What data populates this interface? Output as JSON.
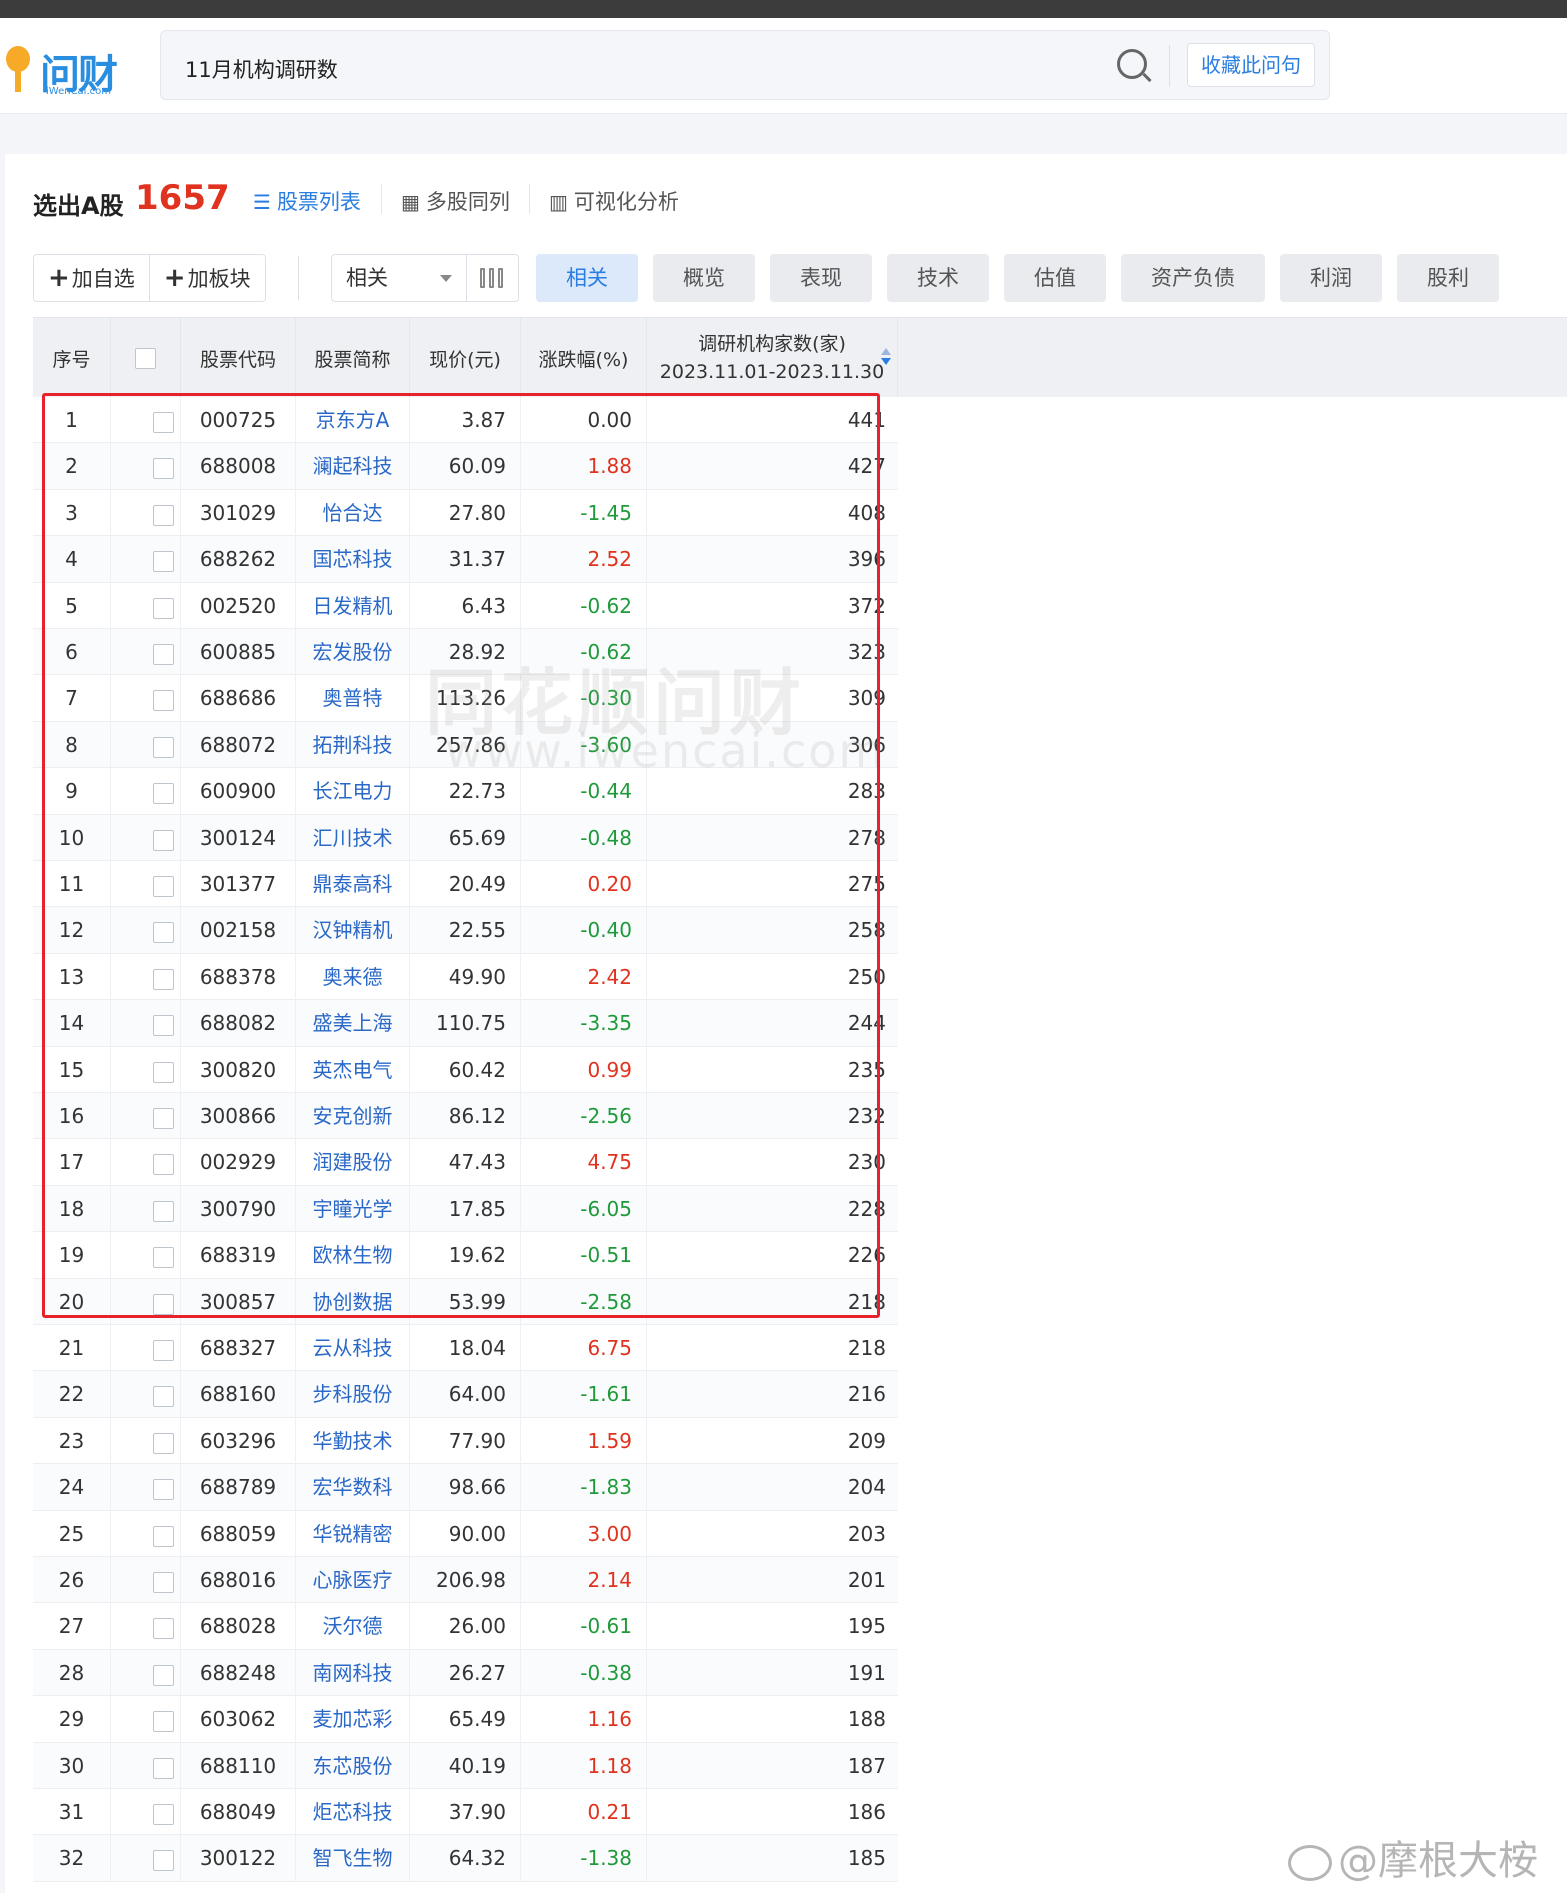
{
  "header": {
    "logo_text": "问财",
    "logo_sub": "iWenCai.com",
    "search_value": "11月机构调研数",
    "fav_label": "收藏此问句"
  },
  "result": {
    "label": "选出A股",
    "count": "1657"
  },
  "view_tabs": [
    {
      "label": "股票列表",
      "icon": "list-icon"
    },
    {
      "label": "多股同列",
      "icon": "grid-icon"
    },
    {
      "label": "可视化分析",
      "icon": "bar-chart-icon"
    }
  ],
  "toolbar": {
    "add_watch": "加自选",
    "add_block": "加板块",
    "select_value": "相关"
  },
  "categories": [
    "相关",
    "概览",
    "表现",
    "技术",
    "估值",
    "资产负债",
    "利润",
    "股利"
  ],
  "table": {
    "headers": {
      "idx": "序号",
      "code": "股票代码",
      "name": "股票简称",
      "price": "现价(元)",
      "chg": "涨跌幅(%)",
      "cnt_title": "调研机构家数(家)",
      "cnt_range": "2023.11.01-2023.11.30"
    },
    "rows": [
      {
        "idx": "1",
        "code": "000725",
        "name": "京东方A",
        "price": "3.87",
        "chg": "0.00",
        "dir": "flat",
        "cnt": "441"
      },
      {
        "idx": "2",
        "code": "688008",
        "name": "澜起科技",
        "price": "60.09",
        "chg": "1.88",
        "dir": "up",
        "cnt": "427"
      },
      {
        "idx": "3",
        "code": "301029",
        "name": "怡合达",
        "price": "27.80",
        "chg": "-1.45",
        "dir": "down",
        "cnt": "408"
      },
      {
        "idx": "4",
        "code": "688262",
        "name": "国芯科技",
        "price": "31.37",
        "chg": "2.52",
        "dir": "up",
        "cnt": "396"
      },
      {
        "idx": "5",
        "code": "002520",
        "name": "日发精机",
        "price": "6.43",
        "chg": "-0.62",
        "dir": "down",
        "cnt": "372"
      },
      {
        "idx": "6",
        "code": "600885",
        "name": "宏发股份",
        "price": "28.92",
        "chg": "-0.62",
        "dir": "down",
        "cnt": "323"
      },
      {
        "idx": "7",
        "code": "688686",
        "name": "奥普特",
        "price": "113.26",
        "chg": "-0.30",
        "dir": "down",
        "cnt": "309"
      },
      {
        "idx": "8",
        "code": "688072",
        "name": "拓荆科技",
        "price": "257.86",
        "chg": "-3.60",
        "dir": "down",
        "cnt": "306"
      },
      {
        "idx": "9",
        "code": "600900",
        "name": "长江电力",
        "price": "22.73",
        "chg": "-0.44",
        "dir": "down",
        "cnt": "283"
      },
      {
        "idx": "10",
        "code": "300124",
        "name": "汇川技术",
        "price": "65.69",
        "chg": "-0.48",
        "dir": "down",
        "cnt": "278"
      },
      {
        "idx": "11",
        "code": "301377",
        "name": "鼎泰高科",
        "price": "20.49",
        "chg": "0.20",
        "dir": "up",
        "cnt": "275"
      },
      {
        "idx": "12",
        "code": "002158",
        "name": "汉钟精机",
        "price": "22.55",
        "chg": "-0.40",
        "dir": "down",
        "cnt": "258"
      },
      {
        "idx": "13",
        "code": "688378",
        "name": "奥来德",
        "price": "49.90",
        "chg": "2.42",
        "dir": "up",
        "cnt": "250"
      },
      {
        "idx": "14",
        "code": "688082",
        "name": "盛美上海",
        "price": "110.75",
        "chg": "-3.35",
        "dir": "down",
        "cnt": "244"
      },
      {
        "idx": "15",
        "code": "300820",
        "name": "英杰电气",
        "price": "60.42",
        "chg": "0.99",
        "dir": "up",
        "cnt": "235"
      },
      {
        "idx": "16",
        "code": "300866",
        "name": "安克创新",
        "price": "86.12",
        "chg": "-2.56",
        "dir": "down",
        "cnt": "232"
      },
      {
        "idx": "17",
        "code": "002929",
        "name": "润建股份",
        "price": "47.43",
        "chg": "4.75",
        "dir": "up",
        "cnt": "230"
      },
      {
        "idx": "18",
        "code": "300790",
        "name": "宇瞳光学",
        "price": "17.85",
        "chg": "-6.05",
        "dir": "down",
        "cnt": "228"
      },
      {
        "idx": "19",
        "code": "688319",
        "name": "欧林生物",
        "price": "19.62",
        "chg": "-0.51",
        "dir": "down",
        "cnt": "226"
      },
      {
        "idx": "20",
        "code": "300857",
        "name": "协创数据",
        "price": "53.99",
        "chg": "-2.58",
        "dir": "down",
        "cnt": "218"
      },
      {
        "idx": "21",
        "code": "688327",
        "name": "云从科技",
        "price": "18.04",
        "chg": "6.75",
        "dir": "up",
        "cnt": "218"
      },
      {
        "idx": "22",
        "code": "688160",
        "name": "步科股份",
        "price": "64.00",
        "chg": "-1.61",
        "dir": "down",
        "cnt": "216"
      },
      {
        "idx": "23",
        "code": "603296",
        "name": "华勤技术",
        "price": "77.90",
        "chg": "1.59",
        "dir": "up",
        "cnt": "209"
      },
      {
        "idx": "24",
        "code": "688789",
        "name": "宏华数科",
        "price": "98.66",
        "chg": "-1.83",
        "dir": "down",
        "cnt": "204"
      },
      {
        "idx": "25",
        "code": "688059",
        "name": "华锐精密",
        "price": "90.00",
        "chg": "3.00",
        "dir": "up",
        "cnt": "203"
      },
      {
        "idx": "26",
        "code": "688016",
        "name": "心脉医疗",
        "price": "206.98",
        "chg": "2.14",
        "dir": "up",
        "cnt": "201"
      },
      {
        "idx": "27",
        "code": "688028",
        "name": "沃尔德",
        "price": "26.00",
        "chg": "-0.61",
        "dir": "down",
        "cnt": "195"
      },
      {
        "idx": "28",
        "code": "688248",
        "name": "南网科技",
        "price": "26.27",
        "chg": "-0.38",
        "dir": "down",
        "cnt": "191"
      },
      {
        "idx": "29",
        "code": "603062",
        "name": "麦加芯彩",
        "price": "65.49",
        "chg": "1.16",
        "dir": "up",
        "cnt": "188"
      },
      {
        "idx": "30",
        "code": "688110",
        "name": "东芯股份",
        "price": "40.19",
        "chg": "1.18",
        "dir": "up",
        "cnt": "187"
      },
      {
        "idx": "31",
        "code": "688049",
        "name": "炬芯科技",
        "price": "37.90",
        "chg": "0.21",
        "dir": "up",
        "cnt": "186"
      },
      {
        "idx": "32",
        "code": "300122",
        "name": "智飞生物",
        "price": "64.32",
        "chg": "-1.38",
        "dir": "down",
        "cnt": "185"
      }
    ]
  },
  "watermark": {
    "line1": "同花顺问财",
    "line2": "www.iwencai.com",
    "weibo": "@摩根大桉"
  },
  "colors": {
    "accent": "#2a7de1",
    "up": "#e0321f",
    "down": "#1f9a3a",
    "highlight_box": "#e8222c"
  }
}
